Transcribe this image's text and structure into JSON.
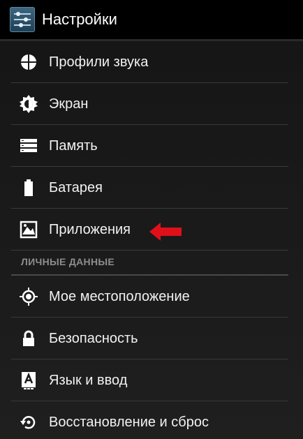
{
  "action_bar": {
    "title": "Настройки",
    "icon": "settings-sliders-icon"
  },
  "device_section": {
    "items": [
      {
        "label": "Профили звука",
        "icon": "sound-profiles-icon"
      },
      {
        "label": "Экран",
        "icon": "display-brightness-icon"
      },
      {
        "label": "Память",
        "icon": "storage-icon"
      },
      {
        "label": "Батарея",
        "icon": "battery-icon"
      },
      {
        "label": "Приложения",
        "icon": "apps-icon"
      }
    ]
  },
  "personal_section": {
    "header": "ЛИЧНЫЕ ДАННЫЕ",
    "items": [
      {
        "label": "Мое местоположение",
        "icon": "location-icon"
      },
      {
        "label": "Безопасность",
        "icon": "lock-icon"
      },
      {
        "label": "Язык и ввод",
        "icon": "language-input-icon"
      },
      {
        "label": "Восстановление и сброс",
        "icon": "backup-reset-icon"
      }
    ]
  },
  "colors": {
    "background": "#1a1a1a",
    "divider": "#3a3a3a",
    "section_header": "#8d8d8d",
    "highlight_arrow": "#e0101a"
  }
}
